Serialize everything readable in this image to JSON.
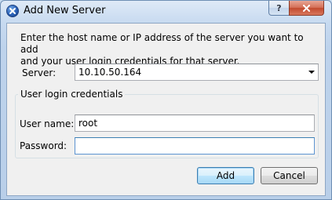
{
  "window": {
    "title": "Add New Server",
    "help_label": "?"
  },
  "intro": {
    "line1": "Enter the host name or IP address of the server you want to add",
    "line2": "and your user login credentials for that server."
  },
  "server": {
    "label": "Server:",
    "value": "10.10.50.164"
  },
  "credentials": {
    "group_title": "User login credentials",
    "username_label": "User name:",
    "username_value": "root",
    "password_label": "Password:",
    "password_value": ""
  },
  "buttons": {
    "add": "Add",
    "cancel": "Cancel"
  },
  "icons": {
    "title_icon": "app-x-icon",
    "close": "close-icon",
    "dropdown": "chevron-down-icon"
  },
  "colors": {
    "titlebar": "#c7daf0",
    "close_button": "#c24a2f",
    "default_button_border": "#3c7fb1",
    "focus_border": "#5d94d1"
  }
}
